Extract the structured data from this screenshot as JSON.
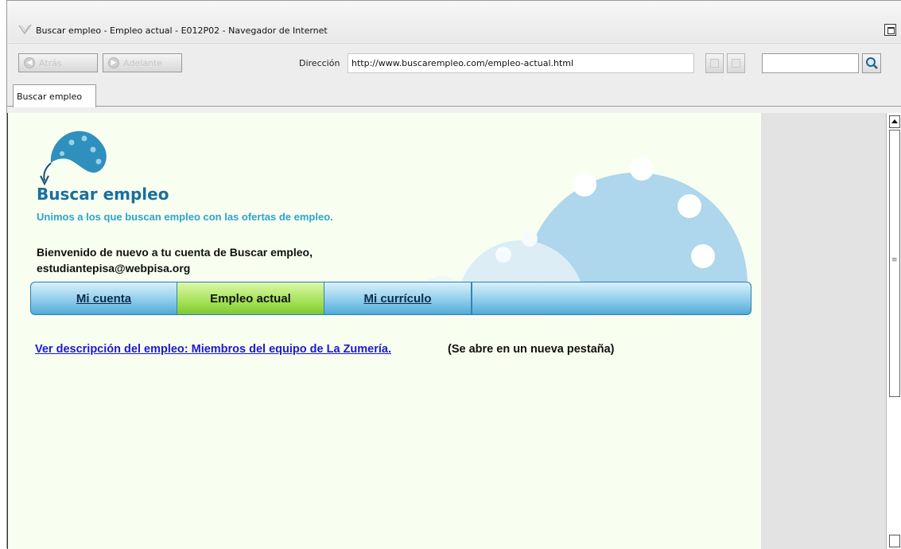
{
  "window": {
    "title": "Buscar empleo - Empleo actual - E012P02 - Navegador de Internet"
  },
  "navbar": {
    "back_label": "Atrás",
    "forward_label": "Adelante",
    "address_label": "Dirección",
    "address_value": "http://www.buscarempleo.com/empleo-actual.html",
    "search_value": ""
  },
  "tabs": [
    {
      "label": "Buscar empleo"
    }
  ],
  "site": {
    "brand_title": "Buscar empleo",
    "tagline": "Unimos a los que buscan empleo con las ofertas de empleo.",
    "welcome_line1": "Bienvenido de nuevo a tu cuenta de Buscar empleo,",
    "welcome_line2": "estudiantepisa@webpisa.org",
    "menu": [
      {
        "label": "Mi cuenta"
      },
      {
        "label": "Empleo actual"
      },
      {
        "label": "Mi currículo"
      }
    ],
    "job_link": "Ver descripción del empleo: Miembros del equipo de La Zumería.",
    "job_note": "(Se abre en un nueva pestaña)"
  },
  "colors": {
    "brand_blue": "#1a6f9e",
    "tagline_blue": "#2ea3cf",
    "active_tab_green": "#9bdd4a",
    "link_blue": "#1a18d8",
    "page_background": "#f9fff0"
  },
  "icons": [
    "browser-logo-icon",
    "maximize-icon",
    "back-arrow-icon",
    "forward-arrow-icon",
    "copy-icon",
    "paste-icon",
    "search-icon",
    "site-logo-icon"
  ]
}
